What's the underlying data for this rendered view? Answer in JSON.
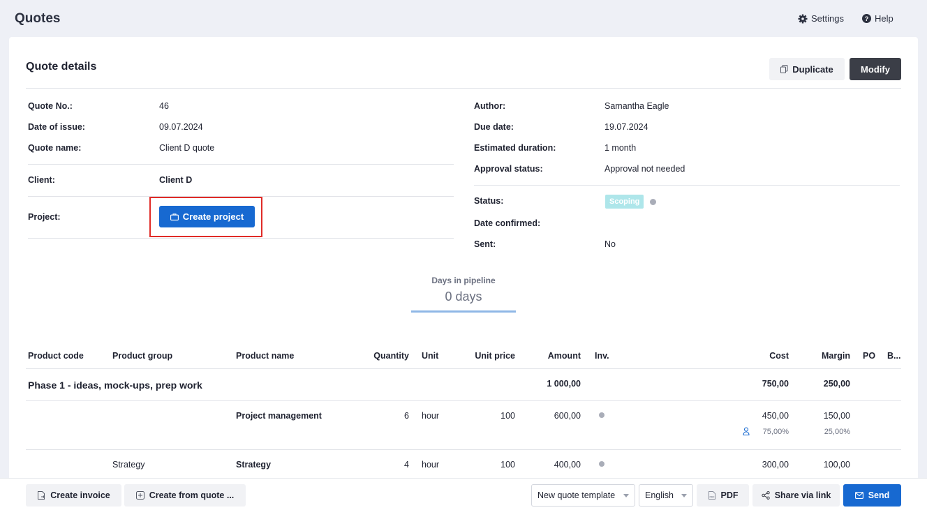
{
  "app": {
    "title": "Quotes",
    "settings_label": "Settings",
    "help_label": "Help"
  },
  "card": {
    "title": "Quote details",
    "duplicate_label": "Duplicate",
    "modify_label": "Modify"
  },
  "left_fields": {
    "quote_no_label": "Quote No.:",
    "quote_no": "46",
    "date_of_issue_label": "Date of issue:",
    "date_of_issue": "09.07.2024",
    "quote_name_label": "Quote name:",
    "quote_name": "Client D quote",
    "client_label": "Client:",
    "client": "Client D",
    "project_label": "Project:",
    "create_project_label": "Create project"
  },
  "right_fields": {
    "author_label": "Author:",
    "author": "Samantha Eagle",
    "due_date_label": "Due date:",
    "due_date": "19.07.2024",
    "estimated_duration_label": "Estimated duration:",
    "estimated_duration": "1 month",
    "approval_status_label": "Approval status:",
    "approval_status": "Approval not needed",
    "status_label": "Status:",
    "status": "Scoping",
    "date_confirmed_label": "Date confirmed:",
    "sent_label": "Sent:",
    "sent": "No"
  },
  "pipeline": {
    "label": "Days in pipeline",
    "value": "0 days"
  },
  "table": {
    "headers": [
      "Product code",
      "Product group",
      "Product name",
      "Quantity",
      "Unit",
      "Unit price",
      "Amount",
      "Inv.",
      "Cost",
      "Margin",
      "PO",
      "B..."
    ],
    "phase": {
      "name": "Phase 1 - ideas, mock-ups, prep work",
      "amount": "1 000,00",
      "cost": "750,00",
      "margin": "250,00"
    },
    "rows": [
      {
        "group": "",
        "name": "Project management",
        "quantity": "6",
        "unit": "hour",
        "unit_price": "100",
        "amount": "600,00",
        "cost": "450,00",
        "margin": "150,00",
        "cost_pct": "75,00%",
        "margin_pct": "25,00%"
      },
      {
        "group": "Strategy",
        "name": "Strategy",
        "quantity": "4",
        "unit": "hour",
        "unit_price": "100",
        "amount": "400,00",
        "cost": "300,00",
        "margin": "100,00"
      }
    ]
  },
  "bottom": {
    "create_invoice_label": "Create invoice",
    "create_from_quote_label": "Create from quote ...",
    "template_select": "New quote template",
    "language_select": "English",
    "pdf_label": "PDF",
    "share_label": "Share via link",
    "send_label": "Send"
  },
  "colors": {
    "primary": "#1769d1",
    "dark_button": "#3b3e47",
    "highlight": "#e02b27",
    "status_badge": "#aee6ea"
  }
}
